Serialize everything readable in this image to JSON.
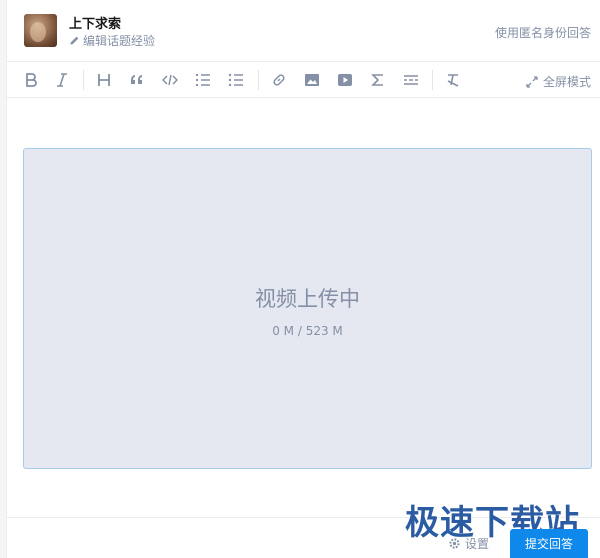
{
  "header": {
    "username": "上下求索",
    "edit_experience": "编辑话题经验",
    "anonymous": "使用匿名身份回答"
  },
  "toolbar": {
    "buttons": [
      "bold-icon",
      "italic-icon",
      "heading-icon",
      "quote-icon",
      "code-icon",
      "ordered-list-icon",
      "unordered-list-icon",
      "link-icon",
      "image-icon",
      "video-icon",
      "formula-icon",
      "divider-icon",
      "clear-format-icon"
    ],
    "fullscreen": "全屏模式"
  },
  "video": {
    "status": "视频上传中",
    "progress": "0 M / 523 M",
    "uploaded_mb": 0,
    "total_mb": 523
  },
  "footer": {
    "settings": "设置",
    "submit": "提交回答"
  },
  "watermark": "极速下载站",
  "colors": {
    "accent": "#0f88eb",
    "muted": "#8590a6",
    "video_bg": "#e5e8f1",
    "video_border": "#a9cbea",
    "watermark": "#1a4f9c"
  }
}
